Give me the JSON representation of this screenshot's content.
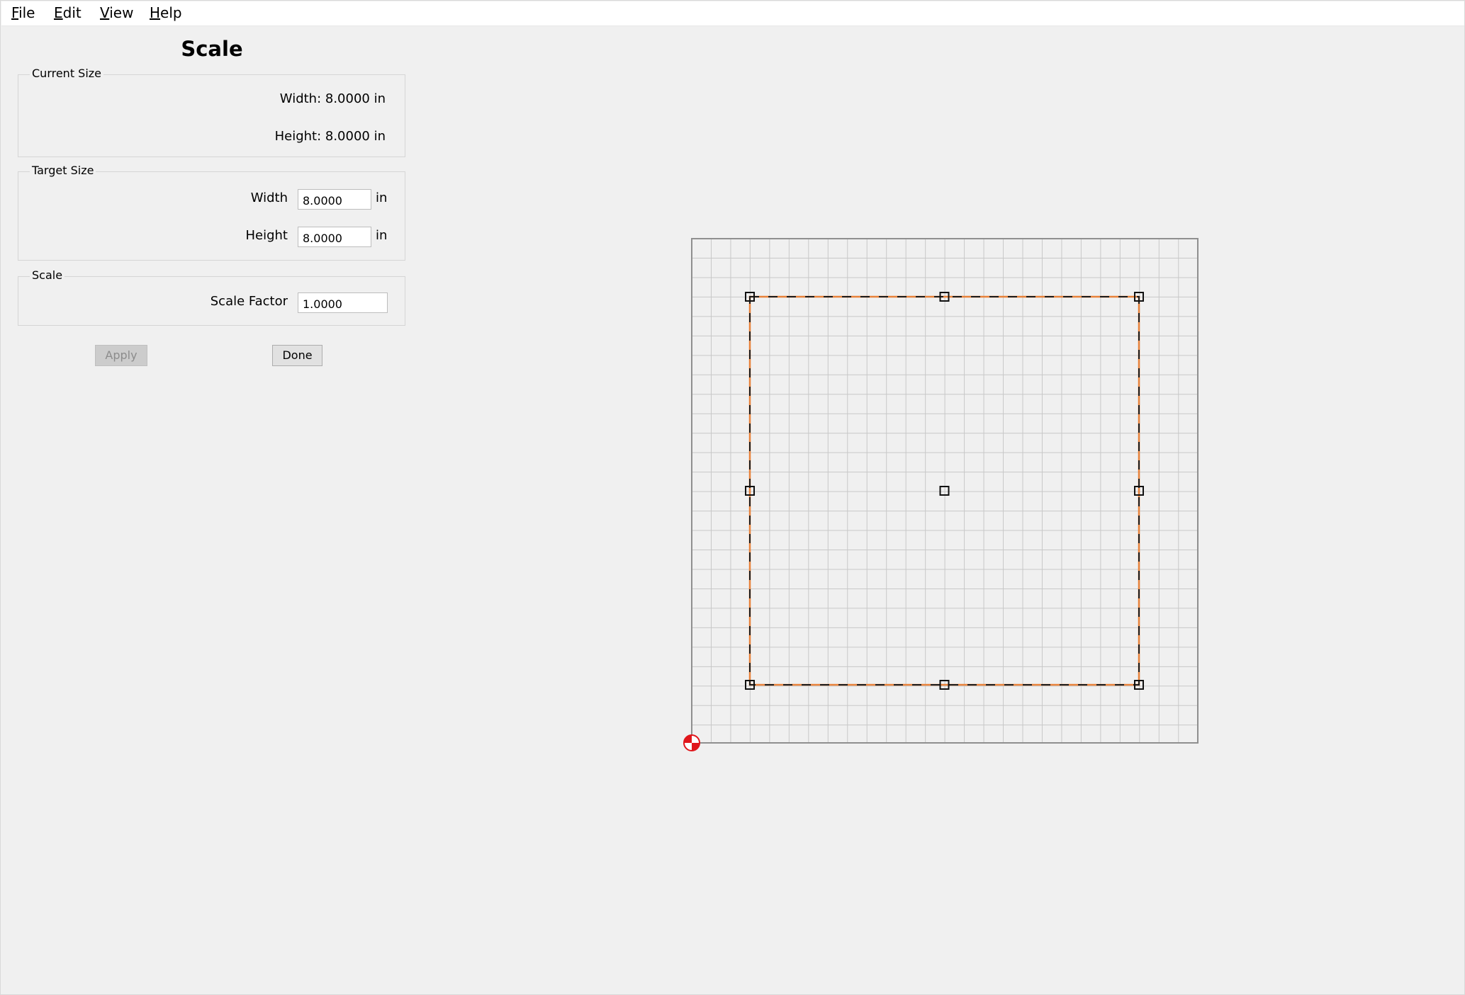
{
  "menu": {
    "file": {
      "mnemonic": "F",
      "rest": "ile"
    },
    "edit": {
      "mnemonic": "E",
      "rest": "dit"
    },
    "view": {
      "mnemonic": "V",
      "rest": "iew"
    },
    "help": {
      "mnemonic": "H",
      "rest": "elp"
    }
  },
  "panel": {
    "title": "Scale",
    "current_size": {
      "legend": "Current Size",
      "width_text": "Width: 8.0000 in",
      "height_text": "Height: 8.0000 in"
    },
    "target_size": {
      "legend": "Target Size",
      "width_label": "Width",
      "width_value": "8.0000",
      "width_unit": "in",
      "height_label": "Height",
      "height_value": "8.0000",
      "height_unit": "in"
    },
    "scale": {
      "legend": "Scale",
      "factor_label": "Scale Factor",
      "factor_value": "1.0000"
    },
    "buttons": {
      "apply": "Apply",
      "done": "Done"
    }
  },
  "canvas": {
    "selection_color": "#e8823a",
    "origin_color": "#e0161b"
  }
}
